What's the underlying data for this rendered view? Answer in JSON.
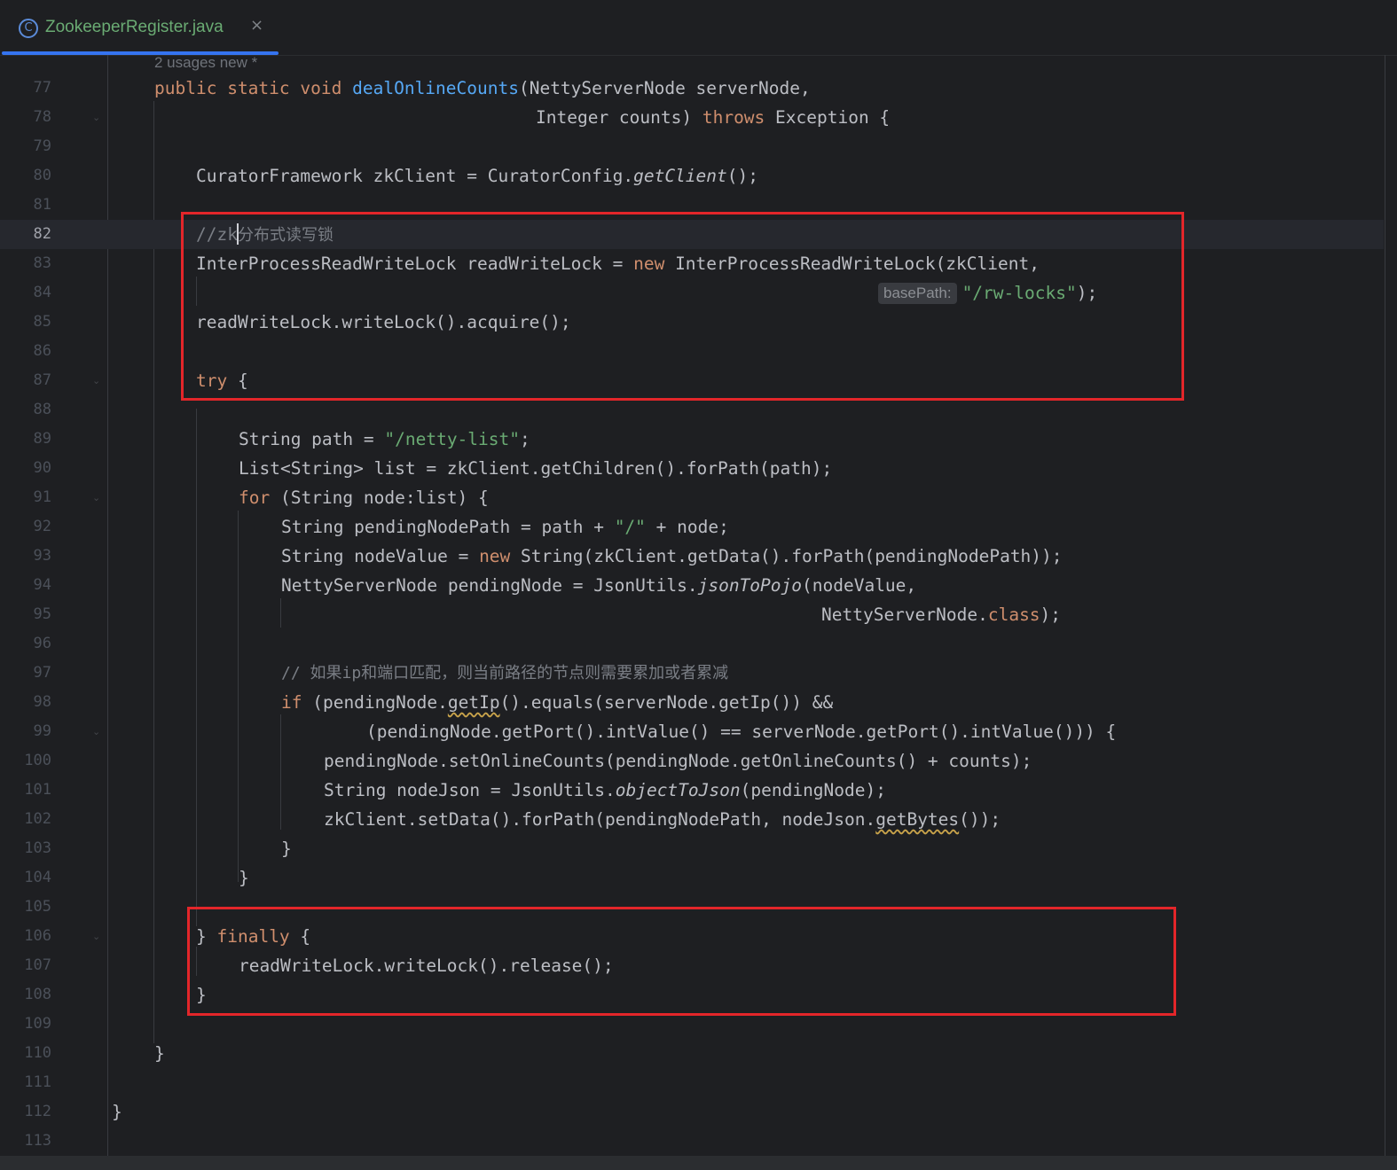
{
  "tab": {
    "icon": "C",
    "title": "ZookeeperRegister.java",
    "close": "×"
  },
  "editor": {
    "inlay_usages": "2 usages   new *",
    "current_line": 82,
    "lines": [
      {
        "n": "77"
      },
      {
        "n": "78"
      },
      {
        "n": "79"
      },
      {
        "n": "80"
      },
      {
        "n": "81"
      },
      {
        "n": "82"
      },
      {
        "n": "83"
      },
      {
        "n": "84"
      },
      {
        "n": "85"
      },
      {
        "n": "86"
      },
      {
        "n": "87"
      },
      {
        "n": "88"
      },
      {
        "n": "89"
      },
      {
        "n": "90"
      },
      {
        "n": "91"
      },
      {
        "n": "92"
      },
      {
        "n": "93"
      },
      {
        "n": "94"
      },
      {
        "n": "95"
      },
      {
        "n": "96"
      },
      {
        "n": "97"
      },
      {
        "n": "98"
      },
      {
        "n": "99"
      },
      {
        "n": "100"
      },
      {
        "n": "101"
      },
      {
        "n": "102"
      },
      {
        "n": "103"
      },
      {
        "n": "104"
      },
      {
        "n": "105"
      },
      {
        "n": "106"
      },
      {
        "n": "107"
      },
      {
        "n": "108"
      },
      {
        "n": "109"
      },
      {
        "n": "110"
      },
      {
        "n": "111"
      },
      {
        "n": "112"
      },
      {
        "n": "113"
      }
    ],
    "tokens": {
      "l77": [
        "public",
        " ",
        "static",
        " ",
        "void",
        " ",
        "dealOnlineCounts",
        "(NettyServerNode serverNode,"
      ],
      "l78": [
        "Integer counts) ",
        "throws",
        " Exception {"
      ],
      "l80a": "CuratorFramework zkClient = CuratorConfig.",
      "l80b": "getClient",
      "l80c": "();",
      "l82a": "//zk",
      "l82b": "分布式读写锁",
      "l83a": "InterProcessReadWriteLock readWriteLock = ",
      "l83b": "new",
      "l83c": " InterProcessReadWriteLock(zkClient,",
      "l84hint": "basePath:",
      "l84str": "\"/rw-locks\"",
      "l84end": ");",
      "l85": "readWriteLock.writeLock().acquire();",
      "l87a": "try",
      "l87b": " {",
      "l89a": "String path = ",
      "l89b": "\"/netty-list\"",
      "l89c": ";",
      "l90": "List<String> list = zkClient.getChildren().forPath(path);",
      "l91a": "for",
      "l91b": " (String node:list) {",
      "l92a": "String pendingNodePath = path + ",
      "l92b": "\"/\"",
      "l92c": " + node;",
      "l93a": "String nodeValue = ",
      "l93b": "new",
      "l93c": " String(zkClient.getData().forPath(pendingNodePath));",
      "l94a": "NettyServerNode pendingNode = JsonUtils.",
      "l94b": "jsonToPojo",
      "l94c": "(nodeValue,",
      "l95a": "NettyServerNode.",
      "l95b": "class",
      "l95c": ");",
      "l97": "// 如果ip和端口匹配，则当前路径的节点则需要累加或者累减",
      "l98a": "if",
      "l98b": " (pendingNode.",
      "l98c": "getIp",
      "l98d": "().equals(serverNode.getIp()) &&",
      "l99": "(pendingNode.getPort().intValue() == serverNode.getPort().intValue())) {",
      "l100": "pendingNode.setOnlineCounts(pendingNode.getOnlineCounts() + counts);",
      "l101a": "String nodeJson = JsonUtils.",
      "l101b": "objectToJson",
      "l101c": "(pendingNode);",
      "l102a": "zkClient.setData().forPath(pendingNodePath, nodeJson.",
      "l102b": "getBytes",
      "l102c": "());",
      "l103": "}",
      "l104": "}",
      "l106a": "}",
      "l106b": " finally",
      "l106c": " {",
      "l107": "readWriteLock.writeLock().release();",
      "l108": "}",
      "l110": "}",
      "l112": "}"
    }
  },
  "colors": {
    "background": "#1e1f22",
    "keyword": "#cf8e6d",
    "function": "#56a8f5",
    "string": "#6aab73",
    "comment": "#7a7e85",
    "highlight_box": "#e3262a",
    "tab_accent": "#3574f0"
  },
  "icons": [
    "class-icon",
    "close-icon",
    "fold-arrow-icon"
  ]
}
